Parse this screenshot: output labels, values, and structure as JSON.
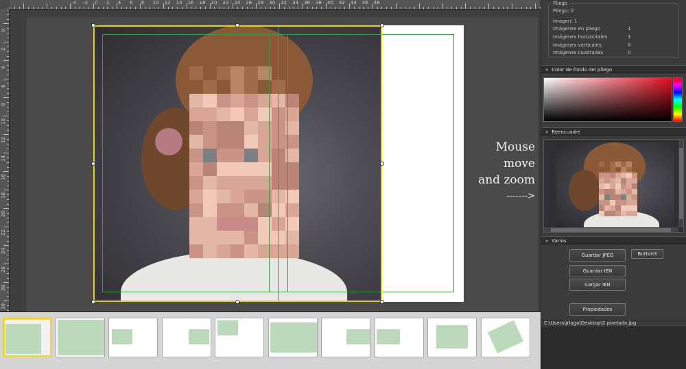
{
  "ruler": {
    "top_labels": [
      "-4",
      "-2",
      "0",
      "2",
      "4",
      "6",
      "8",
      "10",
      "12",
      "14",
      "16",
      "18",
      "20",
      "22",
      "24",
      "26",
      "28",
      "30",
      "32",
      "34",
      "36",
      "38",
      "40",
      "42",
      "44",
      "46",
      "48"
    ],
    "left_labels": [
      "0",
      "2",
      "4",
      "6",
      "8",
      "10",
      "12",
      "14",
      "16",
      "18",
      "20",
      "22",
      "24",
      "26",
      "28",
      "30"
    ]
  },
  "annotation": {
    "line1": "Mouse move",
    "line2": "and zoom",
    "arrow": "------->"
  },
  "panel": {
    "pliego": {
      "header": "Pliego",
      "rows": [
        {
          "label": "Pliego: 0",
          "value": ""
        },
        {
          "label": "Imagen: 1",
          "value": ""
        },
        {
          "label": "Imágenes en pliego",
          "value": "1"
        },
        {
          "label": "Imágenes horizontales",
          "value": "1"
        },
        {
          "label": "Imágenes verticales",
          "value": "0"
        },
        {
          "label": "Imágenes cuadradas",
          "value": "0"
        }
      ]
    },
    "color_section": "Color de fondo del pliego",
    "reencuadre_section": "Reencuadre",
    "varios_section": "Varios",
    "buttons": {
      "guardar_jpeg": "Guardar JPEG",
      "button3": "Button3",
      "guardar_ien": "Guardar IEN",
      "cargar_ien": "Cargar IEN",
      "propiedades": "Propiedades"
    },
    "file_path": "C:\\Users\\jrlago\\Desktop\\2 pixelada.jpg"
  },
  "colors": {
    "selection": "#e6d21e",
    "guide": "#3e9a49",
    "thumb_fill": "#bcd9bb",
    "active_thumb": "#f0d43a"
  },
  "filmstrip": {
    "thumb_count": 10,
    "active_index": 0
  }
}
